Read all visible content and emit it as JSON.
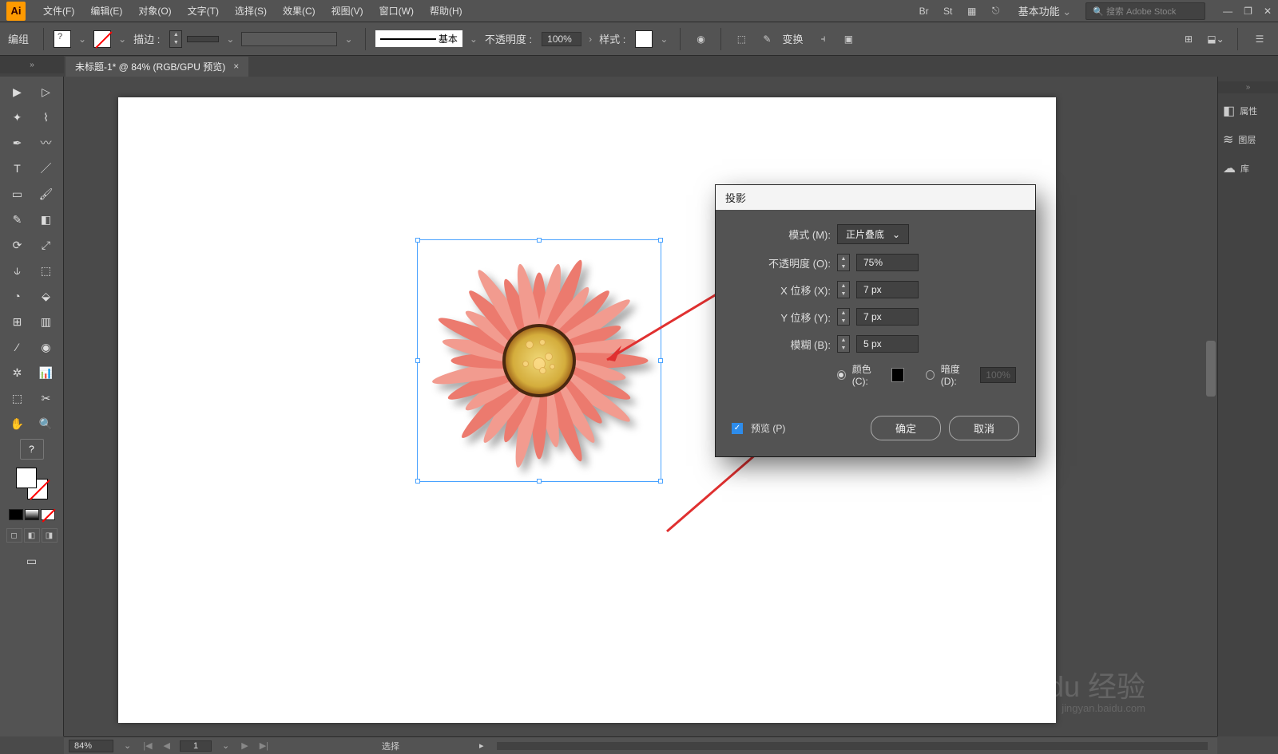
{
  "app": {
    "logo": "Ai"
  },
  "menu": {
    "file": "文件(F)",
    "edit": "编辑(E)",
    "object": "对象(O)",
    "type": "文字(T)",
    "select": "选择(S)",
    "effect": "效果(C)",
    "view": "视图(V)",
    "window": "窗口(W)",
    "help": "帮助(H)"
  },
  "topbar": {
    "workspace": "基本功能",
    "search_placeholder": "搜索 Adobe Stock"
  },
  "control": {
    "context": "编组",
    "fill_q": "?",
    "stroke_label": "描边 :",
    "stroke_style_text": "基本",
    "opacity_label": "不透明度 :",
    "opacity_value": "100%",
    "style_label": "样式 :",
    "transform": "变换"
  },
  "doc_tab": {
    "title": "未标题-1* @ 84% (RGB/GPU 预览)",
    "close": "×"
  },
  "right_panel": {
    "items": [
      {
        "icon": "◧",
        "label": "属性"
      },
      {
        "icon": "≋",
        "label": "图层"
      },
      {
        "icon": "☁",
        "label": "库"
      }
    ]
  },
  "dialog": {
    "title": "投影",
    "mode_label": "模式 (M):",
    "mode_value": "正片叠底",
    "opacity_label": "不透明度 (O):",
    "opacity_value": "75%",
    "x_label": "X 位移 (X):",
    "x_value": "7 px",
    "y_label": "Y 位移 (Y):",
    "y_value": "7 px",
    "blur_label": "模糊 (B):",
    "blur_value": "5 px",
    "color_label": "颜色 (C):",
    "dark_label": "暗度 (D):",
    "dark_value": "100%",
    "preview": "预览 (P)",
    "ok": "确定",
    "cancel": "取消"
  },
  "status": {
    "zoom": "84%",
    "page": "1",
    "mode": "选择"
  },
  "watermark": {
    "main": "Baidu 经验",
    "sub": "jingyan.baidu.com"
  }
}
